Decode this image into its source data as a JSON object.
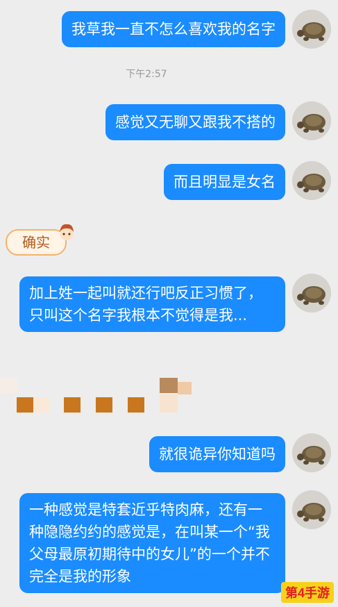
{
  "timestamp": "下午2:57",
  "messages": [
    {
      "text": "我草我一直不怎么喜欢我的名字"
    },
    {
      "text": "感觉又无聊又跟我不搭的"
    },
    {
      "text": "而且明显是女名"
    },
    {
      "text": "加上姓一起叫就还行吧反正习惯了，只叫这个名字我根本不觉得是我..."
    },
    {
      "text": "就很诡异你知道吗"
    },
    {
      "text": "一种感觉是特套近乎特肉麻，还有一种隐隐约约的感觉是，在叫某一个“我父母最原初期待中的女儿”的一个并不完全是我的形象"
    }
  ],
  "sticker": {
    "text": "确实"
  },
  "watermark": {
    "text": "第4手游"
  },
  "colors": {
    "bubble": "#1a8cff",
    "background": "#ededed",
    "avatar": "turtle"
  }
}
